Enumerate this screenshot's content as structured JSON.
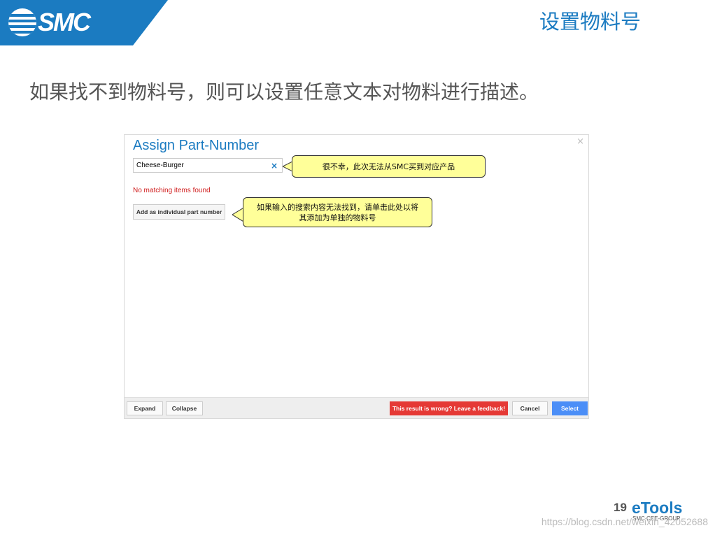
{
  "header": {
    "logo_text": "SMC",
    "slide_title": "设置物料号",
    "brand_color": "#1b7bc1"
  },
  "subtitle": "如果找不到物料号，则可以设置任意文本对物料进行描述。",
  "dialog": {
    "title": "Assign Part-Number",
    "close_icon": "×",
    "search": {
      "value": "Cheese-Burger",
      "clear_icon": "×"
    },
    "no_match_text": "No matching items found",
    "add_button_label": "Add as individual part number",
    "footer": {
      "expand_label": "Expand",
      "collapse_label": "Collapse",
      "feedback_label": "This result is wrong? Leave a feedback!",
      "cancel_label": "Cancel",
      "select_label": "Select"
    }
  },
  "callouts": {
    "search_note": "很不幸，此次无法从SMC买到对应产品",
    "add_note_line1": "如果输入的搜索内容无法找到，请单击此处以将",
    "add_note_line2": "其添加为单独的物料号"
  },
  "footer": {
    "page_number": "19",
    "brand": "eTools",
    "brand_sub": "SMC CEE-GROUP",
    "watermark": "https://blog.csdn.net/weixin_42052688"
  },
  "colors": {
    "callout_bg": "#ffff99",
    "error_red": "#d01c1c",
    "feedback_red": "#e53935",
    "select_blue": "#4b8ef7"
  }
}
